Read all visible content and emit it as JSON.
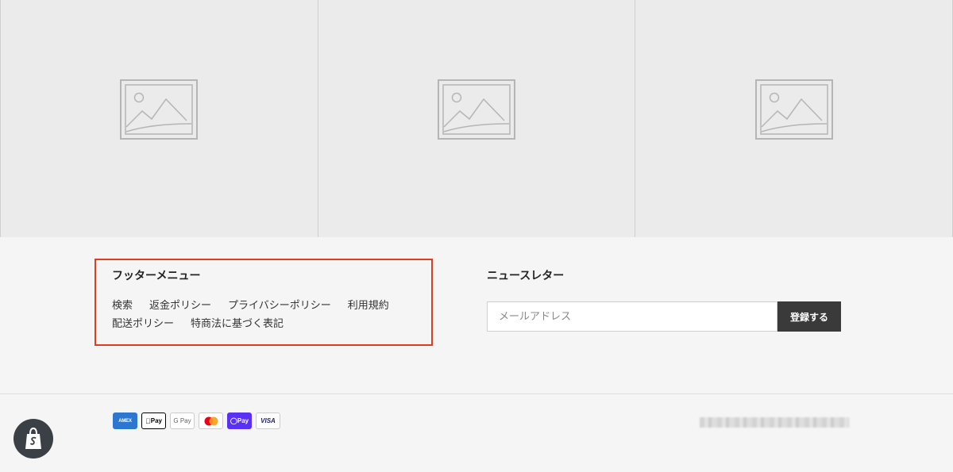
{
  "gallery": {
    "tiles": [
      {
        "icon": "image-placeholder-icon"
      },
      {
        "icon": "image-placeholder-icon"
      },
      {
        "icon": "image-placeholder-icon"
      }
    ]
  },
  "footer_menu": {
    "title": "フッターメニュー",
    "links": [
      "検索",
      "返金ポリシー",
      "プライバシーポリシー",
      "利用規約",
      "配送ポリシー",
      "特商法に基づく表記"
    ]
  },
  "newsletter": {
    "title": "ニュースレター",
    "email_placeholder": "メールアドレス",
    "email_value": "",
    "submit_label": "登録する"
  },
  "payments": [
    {
      "name": "amex",
      "label": "AMEX"
    },
    {
      "name": "apple-pay",
      "label": "Pay"
    },
    {
      "name": "google-pay",
      "label": "G Pay"
    },
    {
      "name": "mastercard",
      "label": ""
    },
    {
      "name": "shop-pay",
      "label": "Pay"
    },
    {
      "name": "visa",
      "label": "VISA"
    }
  ],
  "colors": {
    "highlight_border": "#e53a22",
    "button_bg": "#3a3a3a",
    "shop_pay": "#5a31f4",
    "amex": "#2e77d0"
  },
  "shopify_badge": {
    "icon": "shopify-bag-icon"
  }
}
